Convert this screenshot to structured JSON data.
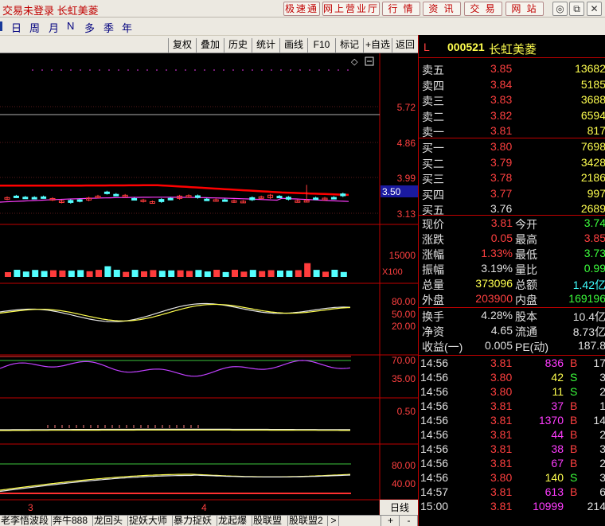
{
  "title": {
    "text": "交易未登录  长虹美菱"
  },
  "toolbar_buttons": [
    {
      "label": "极速通"
    },
    {
      "label": "网上营业厅"
    },
    {
      "label": "行  情"
    },
    {
      "label": "资  讯"
    },
    {
      "label": "交  易"
    },
    {
      "label": "网  站"
    }
  ],
  "window_controls": {
    "restore": "◎",
    "maximize": "⧉",
    "close": "✕"
  },
  "periods": [
    "日",
    "周",
    "月",
    "N",
    "多",
    "季",
    "年"
  ],
  "chart_toolbar": [
    "复权",
    "叠加",
    "历史",
    "统计",
    "画线",
    "F10",
    "标记",
    "+自选",
    "返回"
  ],
  "chart": {
    "price_ticks": [
      "5.72",
      "4.86",
      "3.99",
      "3.13"
    ],
    "current_price_tag": "3.50",
    "volume_tick": "15000",
    "volume_unit": "X100",
    "ind1_ticks": [
      "80.00",
      "50.00",
      "20.00"
    ],
    "ind2_ticks": [
      "70.00",
      "35.00"
    ],
    "ind3_ticks": [
      "0.50"
    ],
    "ind4_ticks": [
      "80.00",
      "40.00"
    ],
    "date_labels": [
      "3",
      "4"
    ],
    "period_label": "日线",
    "colors": {
      "up": "#ff3c3c",
      "down": "#54ffff",
      "ma": "#ff0000",
      "ma2": "#ff3cff",
      "yellow": "#ffff4f",
      "white": "#e6e6e6",
      "green": "#3cc43c"
    }
  },
  "right_panel": {
    "market_flag": "L",
    "code": "000521",
    "name": "长虹美菱",
    "asks": [
      {
        "label": "卖五",
        "price": "3.85",
        "vol": "13682"
      },
      {
        "label": "卖四",
        "price": "3.84",
        "vol": "5185"
      },
      {
        "label": "卖三",
        "price": "3.83",
        "vol": "3688"
      },
      {
        "label": "卖二",
        "price": "3.82",
        "vol": "6594"
      },
      {
        "label": "卖一",
        "price": "3.81",
        "vol": "817"
      }
    ],
    "bids": [
      {
        "label": "买一",
        "price": "3.80",
        "vol": "7698"
      },
      {
        "label": "买二",
        "price": "3.79",
        "vol": "3428"
      },
      {
        "label": "买三",
        "price": "3.78",
        "vol": "2186"
      },
      {
        "label": "买四",
        "price": "3.77",
        "vol": "997"
      },
      {
        "label": "买五",
        "price": "3.76",
        "vol": "2689"
      }
    ],
    "quote": [
      {
        "l1": "现价",
        "v1": "3.81",
        "l2": "今开",
        "v2": "3.74"
      },
      {
        "l1": "涨跌",
        "v1": "0.05",
        "l2": "最高",
        "v2": "3.85"
      },
      {
        "l1": "涨幅",
        "v1": "1.33%",
        "l2": "最低",
        "v2": "3.73"
      },
      {
        "l1": "振幅",
        "v1": "3.19%",
        "l2": "量比",
        "v2": "0.99"
      },
      {
        "l1": "总量",
        "v1": "373096",
        "l2": "总额",
        "v2": "1.42亿"
      },
      {
        "l1": "外盘",
        "v1": "203900",
        "l2": "内盘",
        "v2": "169196"
      }
    ],
    "fundamentals": [
      {
        "l1": "换手",
        "v1": "4.28%",
        "l2": "股本",
        "v2": "10.4亿"
      },
      {
        "l1": "净资",
        "v1": "4.65",
        "l2": "流通",
        "v2": "8.73亿"
      },
      {
        "l1": "收益(一)",
        "v1": "0.005",
        "l2": "PE(动)",
        "v2": "187.8"
      }
    ],
    "ticks": [
      {
        "time": "14:56",
        "price": "3.81",
        "vol": "836",
        "side": "B",
        "num": "17"
      },
      {
        "time": "14:56",
        "price": "3.80",
        "vol": "42",
        "side": "S",
        "num": "3"
      },
      {
        "time": "14:56",
        "price": "3.80",
        "vol": "11",
        "side": "S",
        "num": "2"
      },
      {
        "time": "14:56",
        "price": "3.81",
        "vol": "37",
        "side": "B",
        "num": "1"
      },
      {
        "time": "14:56",
        "price": "3.81",
        "vol": "1370",
        "side": "B",
        "num": "14"
      },
      {
        "time": "14:56",
        "price": "3.81",
        "vol": "44",
        "side": "B",
        "num": "2"
      },
      {
        "time": "14:56",
        "price": "3.81",
        "vol": "38",
        "side": "B",
        "num": "3"
      },
      {
        "time": "14:56",
        "price": "3.81",
        "vol": "67",
        "side": "B",
        "num": "2"
      },
      {
        "time": "14:56",
        "price": "3.80",
        "vol": "140",
        "side": "S",
        "num": "3"
      },
      {
        "time": "14:57",
        "price": "3.81",
        "vol": "613",
        "side": "B",
        "num": "6"
      },
      {
        "time": "15:00",
        "price": "3.81",
        "vol": "10999",
        "side": "",
        "num": "214"
      }
    ]
  },
  "bottom_tabs": [
    "老李悟波段",
    "奔牛888",
    "龙回头",
    "捉妖大师",
    "暴力捉妖",
    "龙起爆",
    "股联盟",
    "股联盟2"
  ],
  "bottom_nav": {
    "arrow": ">",
    "plus": "+",
    "minus": "-"
  }
}
